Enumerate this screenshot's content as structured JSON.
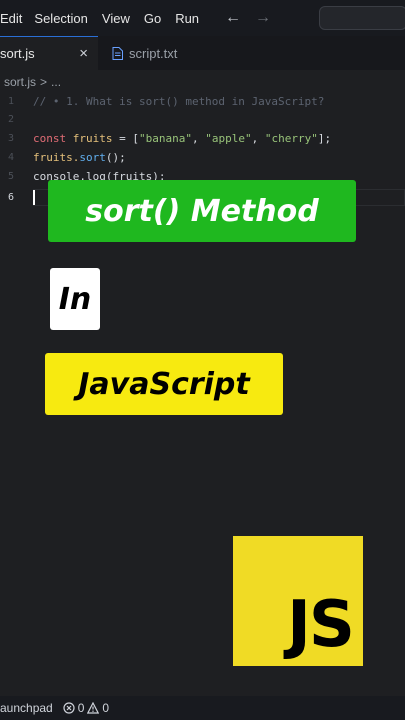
{
  "menu": {
    "items": [
      "Edit",
      "Selection",
      "View",
      "Go",
      "Run"
    ],
    "back_icon": "arrow-left-icon",
    "forward_icon": "arrow-right-icon"
  },
  "tabs": [
    {
      "label": "sort.js",
      "active": true,
      "close": "×"
    },
    {
      "label": "script.txt",
      "active": false,
      "icon": "file-icon"
    }
  ],
  "breadcrumb": {
    "file": "sort.js",
    "separator": ">",
    "more": "..."
  },
  "editor": {
    "lines": [
      {
        "num": "1",
        "text": "// • 1. What is sort() method in JavaScript?"
      },
      {
        "num": "2",
        "text": ""
      },
      {
        "num": "3",
        "kw": "const ",
        "var": "fruits",
        "rest": " = [",
        "s1": "\"banana\"",
        "c1": ", ",
        "s2": "\"apple\"",
        "c2": ", ",
        "s3": "\"cherry\"",
        "end": "];"
      },
      {
        "num": "4",
        "obj": "fruits.",
        "fn": "sort",
        "end": "();"
      },
      {
        "num": "5",
        "text": "console.log(fruits);"
      },
      {
        "num": "6",
        "text": ""
      }
    ]
  },
  "overlay": {
    "title": "sort() Method",
    "in_text": "In",
    "lang": "JavaScript",
    "logo": "JS"
  },
  "status": {
    "launchpad": "aunchpad",
    "errors": "0",
    "warnings": "0",
    "error_icon": "error-circle-icon",
    "warning_icon": "warning-triangle-icon"
  },
  "colors": {
    "green_banner": "#1fb81f",
    "yellow_banner": "#f7ea10",
    "js_logo": "#f0db25",
    "editor_bg": "#1e1f22"
  }
}
